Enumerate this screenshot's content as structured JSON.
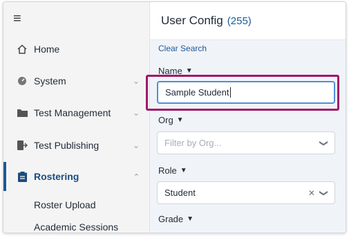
{
  "sidebar": {
    "menu_icon": "hamburger-icon",
    "items": [
      {
        "label": "Home",
        "icon": "home-icon"
      },
      {
        "label": "System",
        "icon": "gauge-icon"
      },
      {
        "label": "Test Management",
        "icon": "folder-icon"
      },
      {
        "label": "Test Publishing",
        "icon": "publish-icon"
      },
      {
        "label": "Rostering",
        "icon": "clipboard-icon"
      }
    ],
    "subitems": [
      "Roster Upload",
      "Academic Sessions"
    ]
  },
  "header": {
    "title": "User Config",
    "count": "(255)"
  },
  "filters": {
    "clear_label": "Clear Search",
    "name_label": "Name",
    "name_value": "Sample Student",
    "org_label": "Org",
    "org_placeholder": "Filter by Org...",
    "role_label": "Role",
    "role_value": "Student",
    "grade_label": "Grade"
  },
  "colors": {
    "accent": "#1a5a96",
    "highlight": "#a0166a",
    "focus": "#4f8fd6"
  }
}
